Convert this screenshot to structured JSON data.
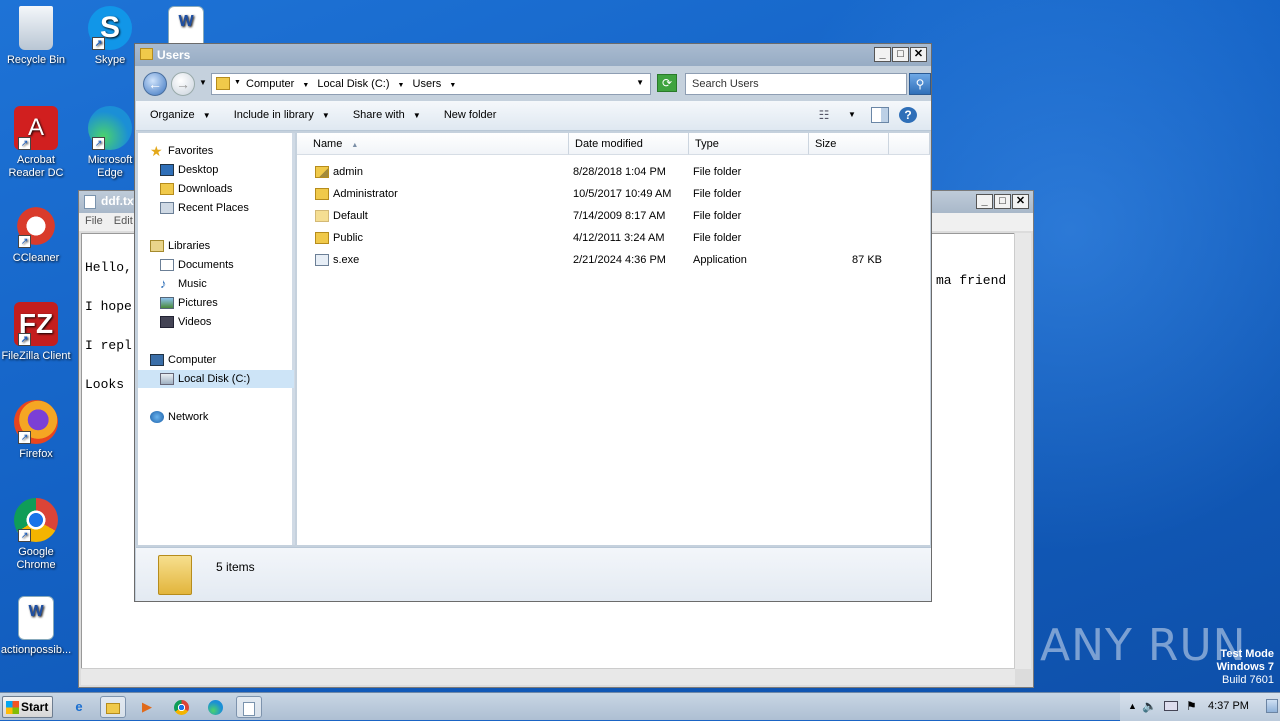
{
  "desktop": {
    "icons": [
      {
        "label": "Recycle Bin",
        "color": "#dfe8f2"
      },
      {
        "label": "Skype",
        "color": "#1196e8"
      },
      {
        "label": "Acrobat Reader DC",
        "color": "#d11f1f"
      },
      {
        "label": "Microsoft Edge",
        "color": "#1da1c8"
      },
      {
        "label": "CCleaner",
        "color": "#2a7cd6"
      },
      {
        "label": "FileZilla Client",
        "color": "#c41e1e"
      },
      {
        "label": "Firefox",
        "color": "#f07a1a"
      },
      {
        "label": "Google Chrome",
        "color": "#2da44e"
      },
      {
        "label": "actionpossib...",
        "color": "#ffffff"
      }
    ],
    "watermark": "ANY RUN",
    "test_mode": {
      "line1": "Test Mode",
      "line2": "Windows 7",
      "line3": "Build 7601"
    }
  },
  "notepad": {
    "title": "ddf.txt",
    "menu": [
      "File",
      "Edit"
    ],
    "lines": [
      "Hello,",
      "I hope",
      "I repl.",
      "Looks "
    ],
    "right_text": "ma friend"
  },
  "explorer": {
    "title": "Users",
    "breadcrumb": [
      "Computer",
      "Local Disk (C:)",
      "Users"
    ],
    "search_placeholder": "Search Users",
    "toolbar": {
      "organize": "Organize",
      "include_in_library": "Include in library",
      "share_with": "Share with",
      "new_folder": "New folder"
    },
    "nav": {
      "favorites": "Favorites",
      "desktop": "Desktop",
      "downloads": "Downloads",
      "recent_places": "Recent Places",
      "libraries": "Libraries",
      "documents": "Documents",
      "music": "Music",
      "pictures": "Pictures",
      "videos": "Videos",
      "computer": "Computer",
      "local_disk": "Local Disk (C:)",
      "network": "Network"
    },
    "columns": {
      "name": "Name",
      "date_modified": "Date modified",
      "type": "Type",
      "size": "Size"
    },
    "rows": [
      {
        "name": "admin",
        "date": "8/28/2018 1:04 PM",
        "type": "File folder",
        "size": ""
      },
      {
        "name": "Administrator",
        "date": "10/5/2017 10:49 AM",
        "type": "File folder",
        "size": ""
      },
      {
        "name": "Default",
        "date": "7/14/2009 8:17 AM",
        "type": "File folder",
        "size": ""
      },
      {
        "name": "Public",
        "date": "4/12/2011 3:24 AM",
        "type": "File folder",
        "size": ""
      },
      {
        "name": "s.exe",
        "date": "2/21/2024 4:36 PM",
        "type": "Application",
        "size": "87 KB"
      }
    ],
    "status": "5 items"
  },
  "taskbar": {
    "start": "Start",
    "clock": "4:37 PM"
  }
}
